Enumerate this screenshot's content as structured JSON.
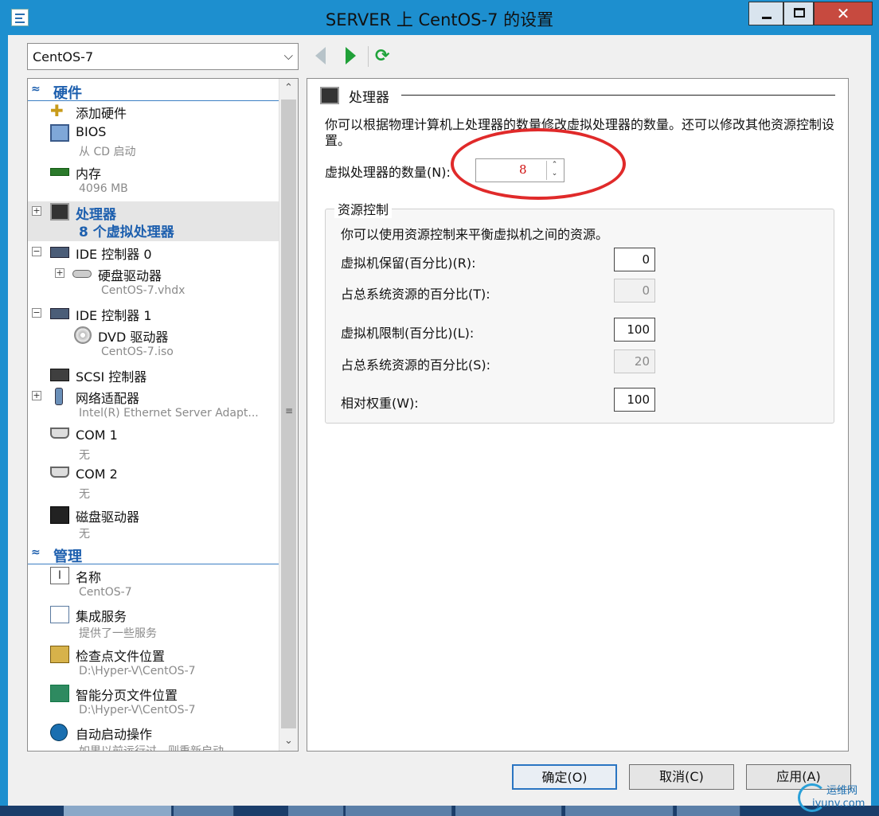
{
  "window": {
    "title": "SERVER 上 CentOS-7 的设置",
    "close_glyph": "✕"
  },
  "vm_selector": {
    "value": "CentOS-7",
    "arrow": "⌵"
  },
  "toolbar": {
    "refresh_glyph": "⟳"
  },
  "tree": {
    "hardware_header": {
      "chevron": "≈",
      "label": "硬件"
    },
    "hardware_items": [
      {
        "name": "添加硬件",
        "sub": ""
      },
      {
        "name": "BIOS",
        "sub": "从 CD 启动"
      },
      {
        "name": "内存",
        "sub": "4096 MB"
      },
      {
        "name": "处理器",
        "sub": "8 个虚拟处理器"
      },
      {
        "name": "IDE 控制器 0",
        "sub": ""
      },
      {
        "name": "硬盘驱动器",
        "sub": "CentOS-7.vhdx"
      },
      {
        "name": "IDE 控制器 1",
        "sub": ""
      },
      {
        "name": "DVD 驱动器",
        "sub": "CentOS-7.iso"
      },
      {
        "name": "SCSI 控制器",
        "sub": ""
      },
      {
        "name": "网络适配器",
        "sub": "Intel(R) Ethernet Server Adapt..."
      },
      {
        "name": "COM 1",
        "sub": "无"
      },
      {
        "name": "COM 2",
        "sub": "无"
      },
      {
        "name": "磁盘驱动器",
        "sub": "无"
      }
    ],
    "management_header": {
      "chevron": "≈",
      "label": "管理"
    },
    "management_items": [
      {
        "name": "名称",
        "sub": "CentOS-7",
        "icon_text": "I"
      },
      {
        "name": "集成服务",
        "sub": "提供了一些服务"
      },
      {
        "name": "检查点文件位置",
        "sub": "D:\\Hyper-V\\CentOS-7"
      },
      {
        "name": "智能分页文件位置",
        "sub": "D:\\Hyper-V\\CentOS-7"
      },
      {
        "name": "自动启动操作",
        "sub": "如果以前运行过，则重新启动"
      }
    ],
    "expander_plus": "+",
    "expander_minus": "−",
    "scroll_up": "⌃",
    "scroll_down": "⌄",
    "scroll_grip": "≡"
  },
  "processor": {
    "header": "处理器",
    "description": "你可以根据物理计算机上处理器的数量修改虚拟处理器的数量。还可以修改其他资源控制设置。",
    "count_label": "虚拟处理器的数量(N):",
    "count_value": "8",
    "spin_up": "⌃",
    "spin_down": "⌄"
  },
  "resource_control": {
    "title": "资源控制",
    "description": "你可以使用资源控制来平衡虚拟机之间的资源。",
    "reserve_label": "虚拟机保留(百分比)(R):",
    "reserve_value": "0",
    "reserve_total_label": "占总系统资源的百分比(T):",
    "reserve_total_value": "0",
    "limit_label": "虚拟机限制(百分比)(L):",
    "limit_value": "100",
    "limit_total_label": "占总系统资源的百分比(S):",
    "limit_total_value": "20",
    "weight_label": "相对权重(W):",
    "weight_value": "100"
  },
  "buttons": {
    "ok": "确定(O)",
    "cancel": "取消(C)",
    "apply": "应用(A)"
  },
  "watermark": {
    "line1": "运维网",
    "line2": "iyunv.com"
  },
  "colors": {
    "accent": "#1d5fae",
    "titlebar": "#1d8fcf",
    "highlight": "#e02a2a"
  }
}
